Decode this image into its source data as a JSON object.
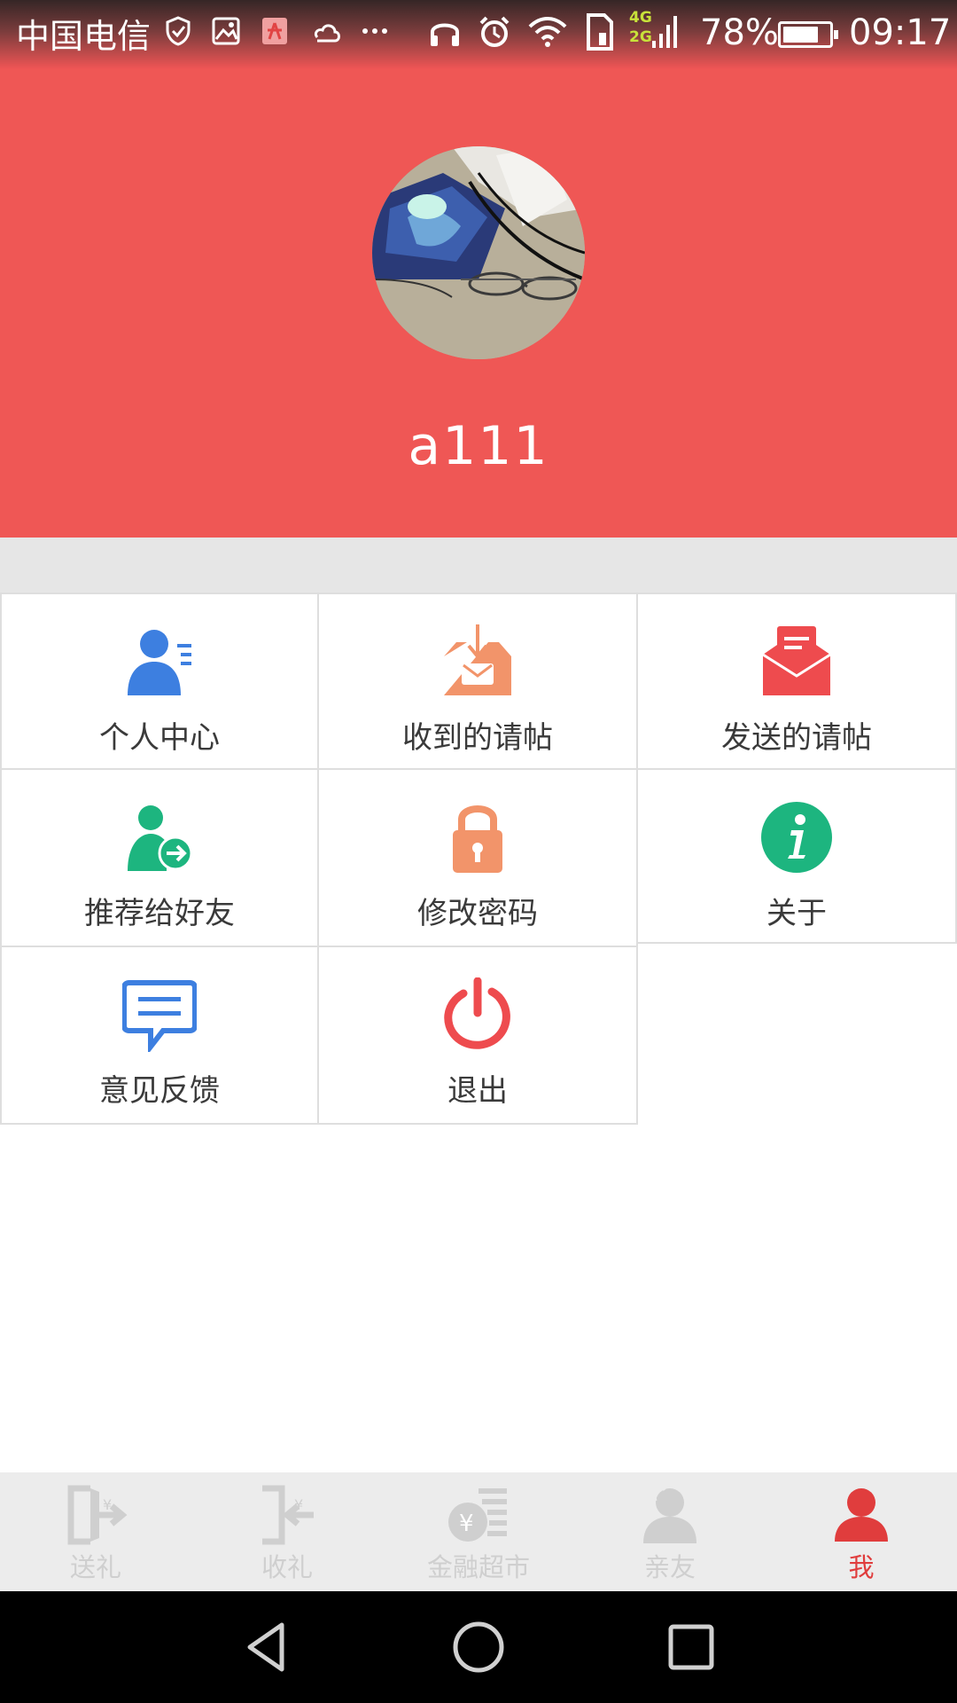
{
  "status_bar": {
    "carrier": "中国电信",
    "network_badges": [
      "4G",
      "2G"
    ],
    "battery_text": "78%",
    "battery_level": 0.78,
    "time": "09:17"
  },
  "profile": {
    "username": "a111"
  },
  "menu": [
    {
      "label": "个人中心",
      "icon": "user-profile-icon",
      "color": "#3d7fe0"
    },
    {
      "label": "收到的请帖",
      "icon": "inbox-mail-icon",
      "color": "#f2946a"
    },
    {
      "label": "发送的请帖",
      "icon": "open-envelope-icon",
      "color": "#ee4b4e"
    },
    {
      "label": "推荐给好友",
      "icon": "share-user-icon",
      "color": "#1db57f"
    },
    {
      "label": "修改密码",
      "icon": "lock-icon",
      "color": "#f2946a"
    },
    {
      "label": "关于",
      "icon": "info-icon",
      "color": "#1db57f"
    },
    {
      "label": "意见反馈",
      "icon": "feedback-chat-icon",
      "color": "#3d7fe0"
    },
    {
      "label": "退出",
      "icon": "power-icon",
      "color": "#ee4b4e"
    }
  ],
  "bottom_nav": {
    "active_color": "#e03d3d",
    "inactive_color": "#cfcfcf",
    "tabs": [
      {
        "label": "送礼",
        "icon": "send-gift-icon",
        "active": false
      },
      {
        "label": "收礼",
        "icon": "receive-gift-icon",
        "active": false
      },
      {
        "label": "金融超市",
        "icon": "finance-market-icon",
        "active": false
      },
      {
        "label": "亲友",
        "icon": "contacts-icon",
        "active": false
      },
      {
        "label": "我",
        "icon": "me-icon",
        "active": true
      }
    ]
  },
  "system_nav": [
    "back-icon",
    "home-icon",
    "recents-icon"
  ],
  "colors": {
    "header_background": "#ef5755",
    "divider_strip": "#e6e6e6"
  }
}
